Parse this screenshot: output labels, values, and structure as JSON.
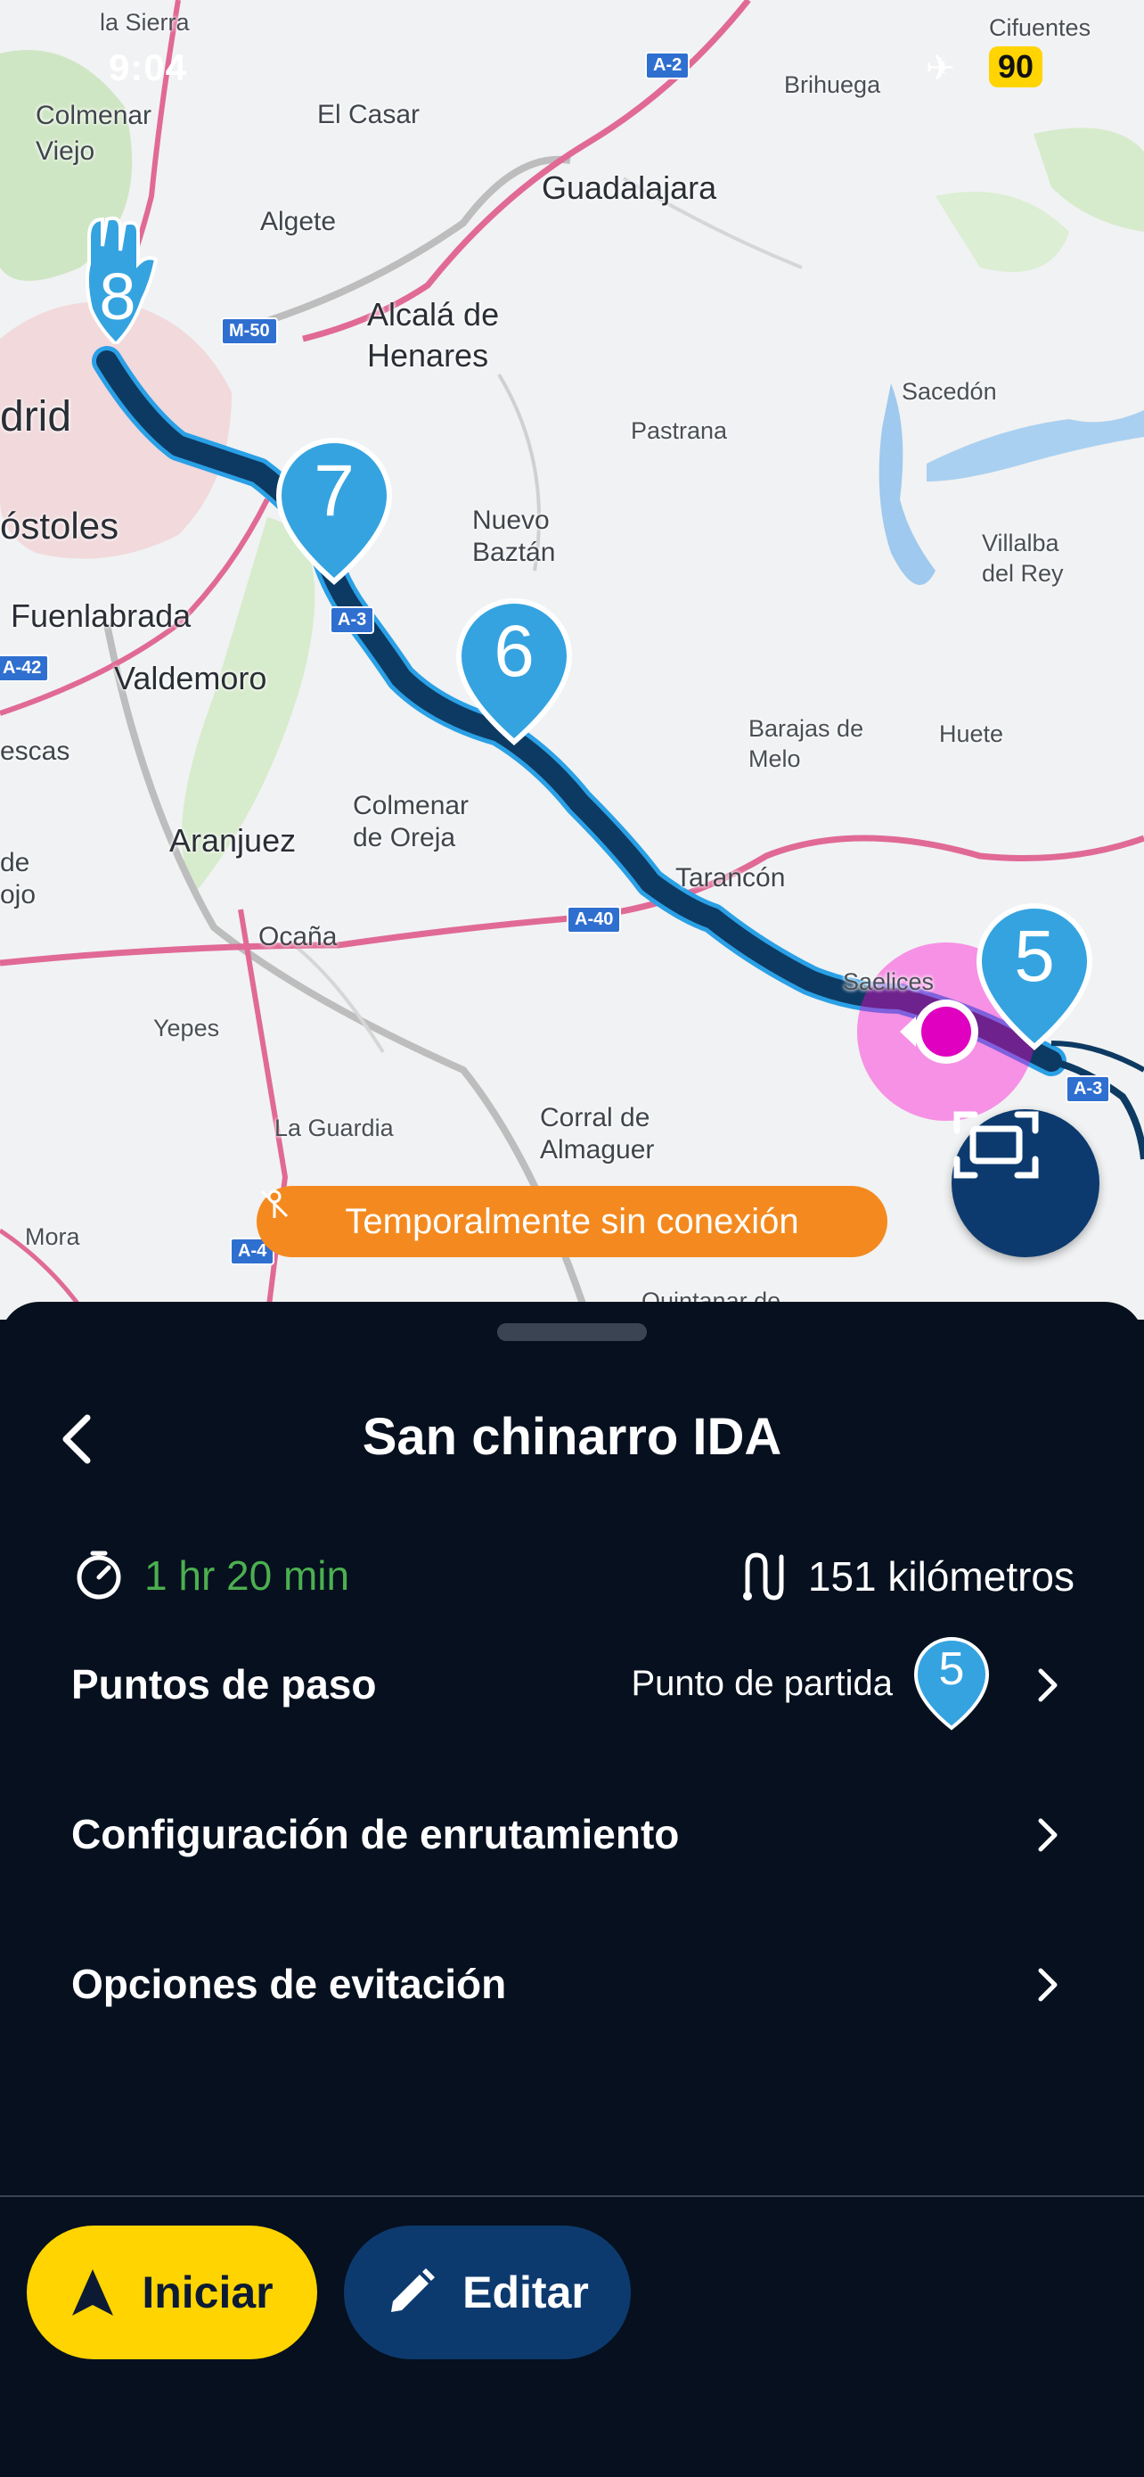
{
  "status_bar": {
    "time": "9:04",
    "battery": "90",
    "plane_icon": "airplane-icon"
  },
  "map": {
    "labels": {
      "la_sierra": "la Sierra",
      "colmenar_viejo": "Colmenar\nViejo",
      "el_casar": "El Casar",
      "brihuega": "Brihuega",
      "cifuentes": "Cifuentes",
      "algete": "Algete",
      "guadalajara": "Guadalajara",
      "alcala": "Alcalá de\nHenares",
      "madrid": "drid",
      "mostoles": "óstoles",
      "sacedon": "Sacedón",
      "pastrana": "Pastrana",
      "nuevo_baztan": "Nuevo\nBaztán",
      "villalba": "Villalba\ndel Rey",
      "fuenlabrada": "Fuenlabrada",
      "valdemoro": "Valdemoro",
      "illescas": "escas",
      "barajas": "Barajas de\nMelo",
      "huete": "Huete",
      "colmenar_oreja": "Colmenar\nde Oreja",
      "aranjuez": "Aranjuez",
      "tarancon": "Tarancón",
      "ocana": "Ocaña",
      "de_ojo": "de\nojo",
      "saelices": "Saelices",
      "yepes": "Yepes",
      "la_guardia": "La Guardia",
      "corral": "Corral de\nAlmaguer",
      "mora": "Mora",
      "quintanar": "Quintanar de"
    },
    "shields": {
      "a2": "A-2",
      "m50": "M-50",
      "a3a": "A-3",
      "a42": "A-42",
      "a40": "A-40",
      "a3b": "A-3",
      "a4": "A-4"
    },
    "waypoints": [
      "8",
      "7",
      "6",
      "5"
    ],
    "offline_banner": "Temporalmente sin conexión",
    "route_color": "#0d3a62",
    "pin_color": "#35a3e0",
    "accent_magenta": "#ff00d0"
  },
  "sheet": {
    "title": "San chinarro IDA",
    "eta": "1 hr 20 min",
    "distance": "151 kilómetros",
    "rows": [
      {
        "label": "Puntos de paso",
        "value": "Punto de partida",
        "waypoint": "5"
      },
      {
        "label": "Configuración de enrutamiento"
      },
      {
        "label": "Opciones de evitación"
      }
    ],
    "buttons": {
      "start": "Iniciar",
      "edit": "Editar"
    }
  }
}
